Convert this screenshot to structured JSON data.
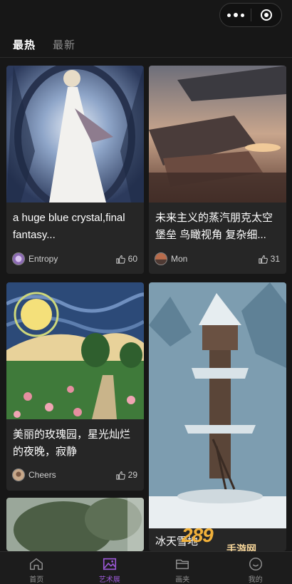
{
  "header": {
    "tabs": [
      {
        "label": "最热",
        "active": true
      },
      {
        "label": "最新",
        "active": false
      }
    ]
  },
  "cards": [
    {
      "caption": "a huge blue crystal,final fantasy...",
      "author": "Entropy",
      "likes": "60"
    },
    {
      "caption": "未来主义的蒸汽朋克太空堡垒 鸟瞰视角 复杂细...",
      "author": "Mon",
      "likes": "31"
    },
    {
      "caption": "美丽的玫瑰园，星光灿烂的夜晚，寂静",
      "author": "Cheers",
      "likes": "29"
    },
    {
      "caption": "冰天雪地",
      "author": "",
      "likes": ""
    },
    {
      "caption": "",
      "author": "",
      "likes": ""
    }
  ],
  "watermark": {
    "brand": "289",
    "sub": "手游网"
  },
  "tabbar": {
    "items": [
      {
        "label": "首页",
        "icon": "home-icon",
        "active": false
      },
      {
        "label": "艺术展",
        "icon": "gallery-icon",
        "active": true
      },
      {
        "label": "画夹",
        "icon": "folder-icon",
        "active": false
      },
      {
        "label": "我的",
        "icon": "profile-icon",
        "active": false
      }
    ]
  },
  "colors": {
    "accent": "#9b59d6",
    "background": "#171717",
    "card": "#262626"
  }
}
